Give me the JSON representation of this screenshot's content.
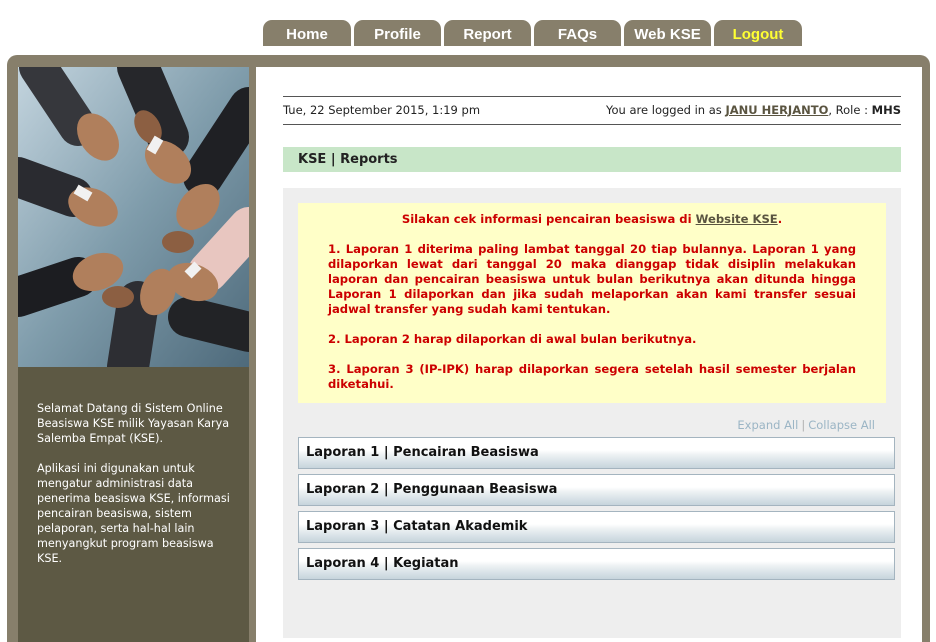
{
  "nav": {
    "tabs": [
      {
        "label": "Home"
      },
      {
        "label": "Profile"
      },
      {
        "label": "Report"
      },
      {
        "label": "FAQs"
      },
      {
        "label": "Web KSE"
      },
      {
        "label": "Logout"
      }
    ],
    "logout_color": "#ffff33"
  },
  "sidebar": {
    "welcome": "Selamat Datang di Sistem Online Beasiswa KSE milik Yayasan Karya Salemba Empat (KSE).",
    "description": "Aplikasi ini digunakan untuk mengatur administrasi data penerima beasiswa KSE, informasi pencairan beasiswa, sistem pelaporan, serta hal-hal lain menyangkut program beasiswa KSE."
  },
  "infobar": {
    "date": "Tue, 22 September 2015, 1:19 pm",
    "logged_prefix": "You are logged in as ",
    "username": "JANU HERJANTO",
    "role_prefix": ", Role : ",
    "role": "MHS"
  },
  "section": {
    "title": "KSE | Reports"
  },
  "notice": {
    "intro_prefix": "Silakan cek informasi pencairan beasiswa di ",
    "intro_link": "Website KSE",
    "intro_suffix": ".",
    "items": [
      "1. Laporan 1 diterima paling lambat tanggal 20 tiap bulannya. Laporan 1 yang dilaporkan lewat dari tanggal 20 maka dianggap tidak disiplin melakukan laporan dan pencairan beasiswa untuk bulan berikutnya akan ditunda hingga Laporan 1 dilaporkan dan jika sudah melaporkan akan kami transfer sesuai jadwal transfer yang sudah kami tentukan.",
      "2. Laporan 2 harap dilaporkan di awal bulan berikutnya.",
      "3. Laporan 3 (IP-IPK) harap dilaporkan segera setelah hasil semester berjalan diketahui."
    ],
    "text_color": "#cc0000",
    "background": "#ffffc8"
  },
  "controls": {
    "expand_all": "Expand All",
    "separator": "|",
    "collapse_all": "Collapse All"
  },
  "accordion": [
    {
      "label": "Laporan 1 | Pencairan Beasiswa"
    },
    {
      "label": "Laporan 2 | Penggunaan Beasiswa"
    },
    {
      "label": "Laporan 3 | Catatan Akademik"
    },
    {
      "label": "Laporan 4 | Kegiatan"
    }
  ],
  "colors": {
    "frame": "#877f6b",
    "sidebar": "#5d5944",
    "section_bar": "#c8e6c8"
  }
}
